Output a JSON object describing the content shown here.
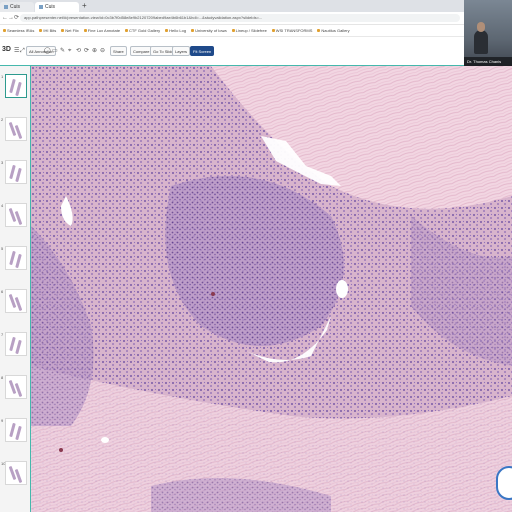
{
  "browser": {
    "tabs": [
      {
        "label": "Cuis"
      },
      {
        "label": "Cuis"
      }
    ],
    "new_tab": "+",
    "nav": {
      "back": "←",
      "forward": "→",
      "reload": "⟳"
    },
    "url": "app.pathpresenter.net/#/presentation-view/id=0c3b7f0d58e8e9b21207209abed9ae4b6b61b1&hdl=...&studyvalidation.aspx?slideIds=...",
    "bookmarks": [
      "Seamless IRAs",
      "IHI Bits",
      "Net Flix",
      "Fine Lux Annotate",
      "CTF Gold Gallery",
      "Hello Log",
      "University of Iowa",
      "Lineup / Slidefree",
      "WSI TRANSFORMS",
      "Nautilus Gallery"
    ]
  },
  "video": {
    "name": "Dr. Thomas Chanis"
  },
  "toolbar": {
    "logo": "3D",
    "buttons": [
      "All Annotation",
      "Share",
      "Compare",
      "Go To Slides",
      "Layers",
      "Fit Screen"
    ],
    "active_button": "Fit Screen"
  },
  "sidebar": {
    "thumbnails": [
      {
        "num": "1"
      },
      {
        "num": "2"
      },
      {
        "num": "3"
      },
      {
        "num": "4"
      },
      {
        "num": "5"
      },
      {
        "num": "6"
      },
      {
        "num": "7"
      },
      {
        "num": "8"
      },
      {
        "num": "9"
      },
      {
        "num": "10"
      }
    ]
  },
  "viewer": {
    "colors": {
      "stroma": "#e8c4d4",
      "collagen": "#f0d4e0",
      "nuclei": "#6a4a9a",
      "dense": "#b090c8"
    }
  }
}
